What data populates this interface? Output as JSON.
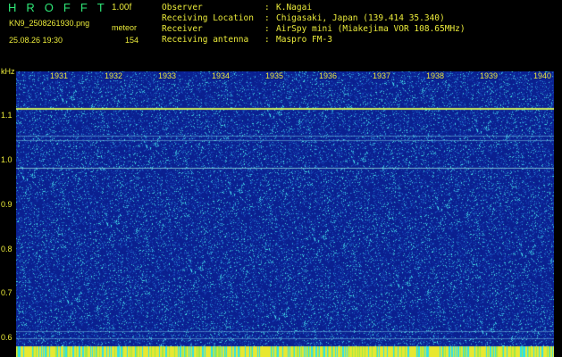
{
  "header": {
    "title": "HROFFT",
    "version": "1.00f",
    "filename": "KN9_2508261930.png",
    "meteor_label": "meteor",
    "datetime": "25.08.26 19:30",
    "meteor_count": "154"
  },
  "info": [
    {
      "label": "Observer",
      "value": "K.Nagai"
    },
    {
      "label": "Receiving Location",
      "value": "Chigasaki, Japan (139.414 35.340)"
    },
    {
      "label": "Receiver",
      "value": "AirSpy mini (Miakejima VOR 108.65MHz)"
    },
    {
      "label": "Receiving antenna",
      "value": "Maspro FM-3"
    }
  ],
  "colon": ":",
  "axis": {
    "unit": "kHz",
    "freq_ticks": [
      {
        "label": "1.1",
        "value": 1.1
      },
      {
        "label": "1.0",
        "value": 1.0
      },
      {
        "label": "0.9",
        "value": 0.9
      },
      {
        "label": "0.8",
        "value": 0.8
      },
      {
        "label": "0.7",
        "value": 0.7
      },
      {
        "label": "0.6",
        "value": 0.6
      }
    ],
    "minute_labels": [
      "1931",
      "1932",
      "1933",
      "1934",
      "1935",
      "1936",
      "1937",
      "1938",
      "1939",
      "1940"
    ]
  },
  "colors": {
    "background": "#000000",
    "spectrogram_base": "#0a1f8e",
    "text": "#eaea3a",
    "title": "#2ee676",
    "carrier_line": "#c8e85a"
  }
}
